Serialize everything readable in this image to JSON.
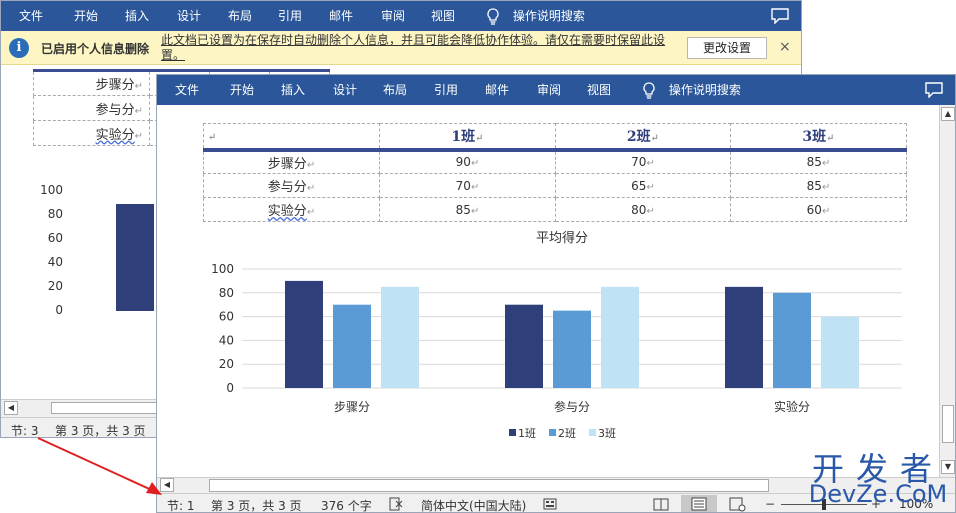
{
  "ribbon": {
    "tabs": [
      "文件",
      "开始",
      "插入",
      "设计",
      "布局",
      "引用",
      "邮件",
      "审阅",
      "视图"
    ],
    "search": "操作说明搜索"
  },
  "info_bar": {
    "title": "已启用个人信息删除",
    "message": "此文档已设置为在保存时自动删除个人信息，并且可能会降低协作体验。请仅在需要时保留此设置。",
    "button": "更改设置",
    "close": "×"
  },
  "table": {
    "headers": [
      "",
      "1班",
      "2班",
      "3班"
    ],
    "rows": [
      {
        "label": "步骤分",
        "values": [
          "90",
          "70",
          "85"
        ]
      },
      {
        "label": "参与分",
        "values": [
          "70",
          "65",
          "85"
        ]
      },
      {
        "label": "实验分",
        "values": [
          "85",
          "80",
          "60"
        ]
      }
    ],
    "end_mark": "↵"
  },
  "back_status": {
    "section": "节: 3",
    "page": "第 3 页，共 3 页"
  },
  "front_status": {
    "section": "节: 1",
    "page": "第 3 页，共 3 页",
    "words": "376 个字",
    "language": "简体中文(中国大陆)",
    "zoom": "100%"
  },
  "colors": {
    "ribbon": "#2b579a",
    "series1": "#2f3f7a",
    "series2": "#5b9bd5",
    "series3": "#bfe3f5",
    "arrow": "#e02020"
  },
  "watermark": {
    "line1": "开发者",
    "line2": "DevZe.CoM"
  },
  "chart_data": {
    "type": "bar",
    "title": "平均得分",
    "categories": [
      "步骤分",
      "参与分",
      "实验分"
    ],
    "series": [
      {
        "name": "1班",
        "values": [
          90,
          70,
          85
        ]
      },
      {
        "name": "2班",
        "values": [
          70,
          65,
          80
        ]
      },
      {
        "name": "3班",
        "values": [
          85,
          85,
          60
        ]
      }
    ],
    "yticks": [
      "0",
      "20",
      "40",
      "60",
      "80",
      "100"
    ],
    "ylim": [
      0,
      100
    ],
    "grid": true,
    "legend": "bottom",
    "back_window_yticks": [
      "100",
      "80",
      "60",
      "40",
      "20",
      "0"
    ]
  }
}
